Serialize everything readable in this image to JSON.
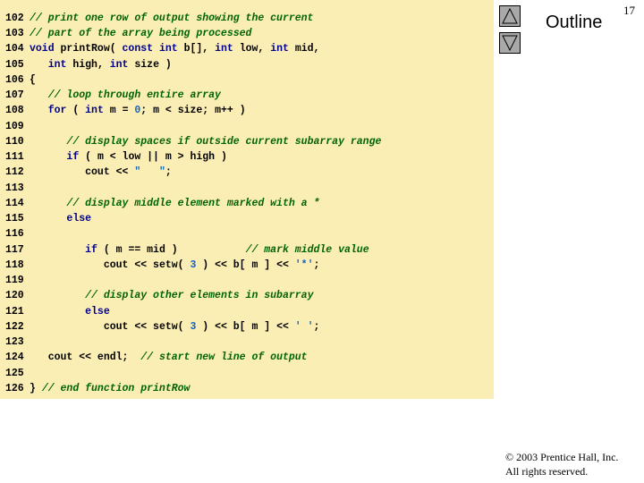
{
  "page_number": "17",
  "outline": {
    "title": "Outline"
  },
  "nav": {
    "up_icon": "triangle-up-icon",
    "down_icon": "triangle-down-icon"
  },
  "copyright": {
    "line1": "© 2003 Prentice Hall, Inc.",
    "line2": "All rights reserved."
  },
  "colors": {
    "code_background": "#fbeeb5",
    "comment": "#006400",
    "keyword": "#00008b",
    "literal": "#1565c0"
  },
  "code": [
    {
      "n": "102",
      "indent": 0,
      "tokens": [
        [
          "cm",
          "// print one row of output showing the current"
        ]
      ]
    },
    {
      "n": "103",
      "indent": 0,
      "tokens": [
        [
          "cm",
          "// part of the array being processed"
        ]
      ]
    },
    {
      "n": "104",
      "indent": 0,
      "tokens": [
        [
          "kw",
          "void"
        ],
        [
          "",
          " printRow( "
        ],
        [
          "kw",
          "const"
        ],
        [
          "",
          " "
        ],
        [
          "kw",
          "int"
        ],
        [
          "",
          " b[], "
        ],
        [
          "kw",
          "int"
        ],
        [
          "",
          " low, "
        ],
        [
          "kw",
          "int"
        ],
        [
          "",
          " mid,"
        ]
      ]
    },
    {
      "n": "105",
      "indent": 3,
      "tokens": [
        [
          "kw",
          "int"
        ],
        [
          "",
          " high, "
        ],
        [
          "kw",
          "int"
        ],
        [
          "",
          " size )"
        ]
      ]
    },
    {
      "n": "106",
      "indent": 0,
      "tokens": [
        [
          "",
          "{"
        ]
      ]
    },
    {
      "n": "107",
      "indent": 3,
      "tokens": [
        [
          "cm",
          "// loop through entire array"
        ]
      ]
    },
    {
      "n": "108",
      "indent": 3,
      "tokens": [
        [
          "kw",
          "for"
        ],
        [
          "",
          " ( "
        ],
        [
          "kw",
          "int"
        ],
        [
          "",
          " m = "
        ],
        [
          "nm",
          "0"
        ],
        [
          "",
          "; m < size; m++ )"
        ]
      ]
    },
    {
      "n": "109",
      "indent": 0,
      "tokens": []
    },
    {
      "n": "110",
      "indent": 6,
      "tokens": [
        [
          "cm",
          "// display spaces if outside current subarray range"
        ]
      ]
    },
    {
      "n": "111",
      "indent": 6,
      "tokens": [
        [
          "kw",
          "if"
        ],
        [
          "",
          " ( m < low || m > high )"
        ]
      ]
    },
    {
      "n": "112",
      "indent": 9,
      "tokens": [
        [
          "",
          "cout << "
        ],
        [
          "st",
          "\"   \""
        ],
        [
          "",
          ";"
        ]
      ]
    },
    {
      "n": "113",
      "indent": 0,
      "tokens": []
    },
    {
      "n": "114",
      "indent": 6,
      "tokens": [
        [
          "cm",
          "// display middle element marked with a *"
        ]
      ]
    },
    {
      "n": "115",
      "indent": 6,
      "tokens": [
        [
          "kw",
          "else"
        ]
      ]
    },
    {
      "n": "116",
      "indent": 0,
      "tokens": []
    },
    {
      "n": "117",
      "indent": 9,
      "tokens": [
        [
          "kw",
          "if"
        ],
        [
          "",
          " ( m == mid )           "
        ],
        [
          "cm",
          "// mark middle value"
        ]
      ]
    },
    {
      "n": "118",
      "indent": 12,
      "tokens": [
        [
          "",
          "cout << setw( "
        ],
        [
          "nm",
          "3"
        ],
        [
          "",
          " ) << b[ m ] << "
        ],
        [
          "st",
          "'*'"
        ],
        [
          "",
          ";"
        ]
      ]
    },
    {
      "n": "119",
      "indent": 0,
      "tokens": []
    },
    {
      "n": "120",
      "indent": 9,
      "tokens": [
        [
          "cm",
          "// display other elements in subarray"
        ]
      ]
    },
    {
      "n": "121",
      "indent": 9,
      "tokens": [
        [
          "kw",
          "else"
        ]
      ]
    },
    {
      "n": "122",
      "indent": 12,
      "tokens": [
        [
          "",
          "cout << setw( "
        ],
        [
          "nm",
          "3"
        ],
        [
          "",
          " ) << b[ m ] << "
        ],
        [
          "st",
          "' '"
        ],
        [
          "",
          ";"
        ]
      ]
    },
    {
      "n": "123",
      "indent": 0,
      "tokens": []
    },
    {
      "n": "124",
      "indent": 3,
      "tokens": [
        [
          "",
          "cout << endl;  "
        ],
        [
          "cm",
          "// start new line of output"
        ]
      ]
    },
    {
      "n": "125",
      "indent": 0,
      "tokens": []
    },
    {
      "n": "126",
      "indent": 0,
      "tokens": [
        [
          "",
          "} "
        ],
        [
          "cm",
          "// end function printRow"
        ]
      ]
    }
  ]
}
